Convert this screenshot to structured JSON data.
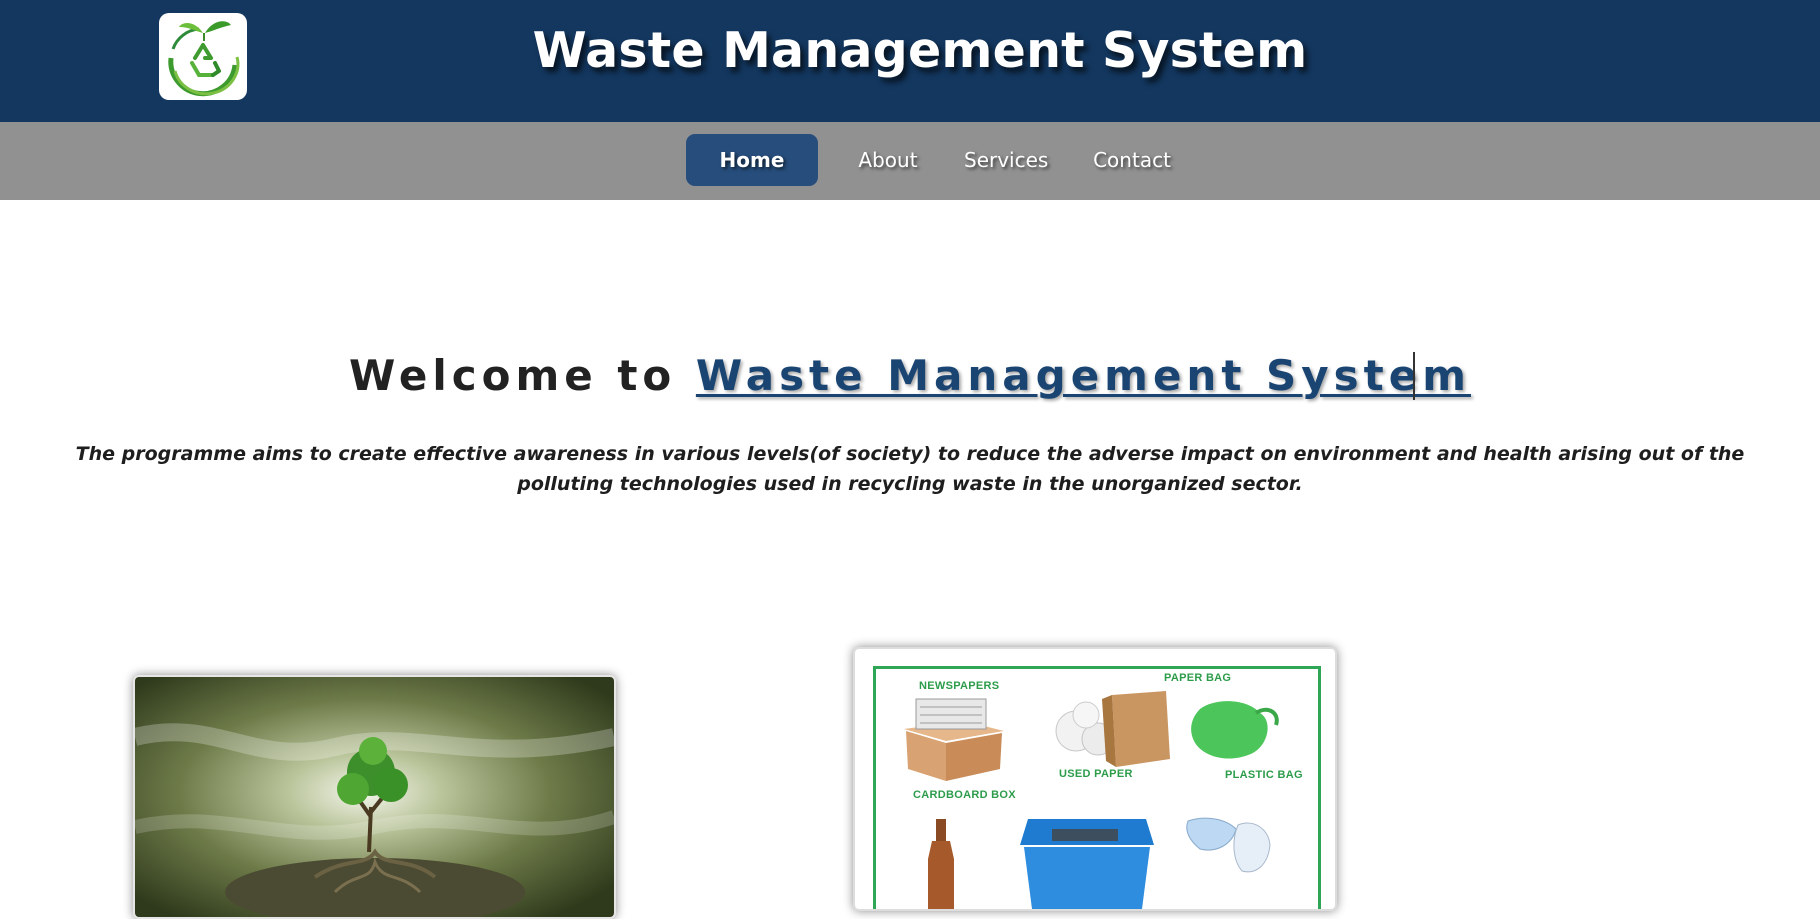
{
  "header": {
    "title": "Waste Management System",
    "logo_icon": "recycle-leaf-logo-icon"
  },
  "nav": {
    "items": [
      {
        "label": "Home",
        "active": true
      },
      {
        "label": "About",
        "active": false
      },
      {
        "label": "Services",
        "active": false
      },
      {
        "label": "Contact",
        "active": false
      }
    ]
  },
  "welcome": {
    "prefix": "Welcome to",
    "highlight": "Waste Management System"
  },
  "intro_text": "The programme aims to create effective awareness in various levels(of society) to reduce the adverse impact on environment and health arising out of the polluting technologies used in recycling waste in the unorganized sector.",
  "waste_image": {
    "labels": {
      "newspapers": "NEWSPAPERS",
      "paper_bag": "PAPER BAG",
      "used_paper": "USED PAPER",
      "plastic_bag": "PLASTIC BAG",
      "cardboard_box": "CARDBOARD BOX"
    }
  },
  "colors": {
    "header_bg": "#13375f",
    "nav_bg": "#919191",
    "active_tab": "#264d7b",
    "link": "#1a4572",
    "frame_green": "#2fa655"
  }
}
